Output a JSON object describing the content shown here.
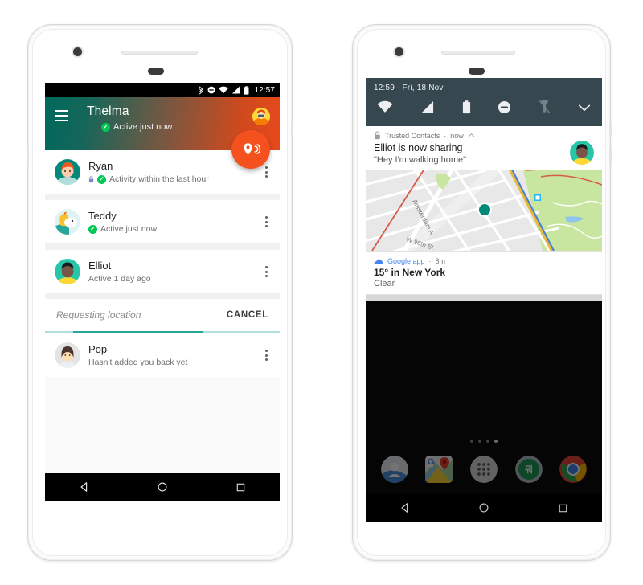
{
  "left_phone": {
    "status_bar": {
      "icons": [
        "bluetooth-icon",
        "do-not-disturb-icon",
        "wifi-icon",
        "cell-signal-icon",
        "battery-icon"
      ],
      "clock": "12:57"
    },
    "app_bar": {
      "menu_icon": "hamburger-menu-icon",
      "title": "Thelma",
      "status_icon": "verified-check-icon",
      "status": "Active just now",
      "profile_avatar": "user-avatar",
      "gradient_start": "#00695C",
      "gradient_end": "#E8491B"
    },
    "fab": {
      "label": "Share location",
      "icon": "location-broadcast-icon",
      "color": "#F4511E"
    },
    "contacts": [
      {
        "name": "Ryan",
        "status": "Activity within the last hour",
        "has_lock": true,
        "has_check": true,
        "avatar": "ryan-avatar",
        "menu": "overflow-menu-icon"
      },
      {
        "name": "Teddy",
        "status": "Active just now",
        "has_lock": false,
        "has_check": true,
        "avatar": "teddy-avatar",
        "menu": "overflow-menu-icon"
      },
      {
        "name": "Elliot",
        "status": "Active 1 day ago",
        "has_lock": false,
        "has_check": false,
        "avatar": "elliot-avatar",
        "menu": "overflow-menu-icon"
      }
    ],
    "requesting": {
      "label": "Requesting location",
      "cancel_label": "CANCEL",
      "progress_color": "#26A69A",
      "progress_track": "#B2DFDB"
    },
    "pending_contact": {
      "name": "Pop",
      "status": "Hasn't added you back yet",
      "avatar": "pop-avatar",
      "menu": "overflow-menu-icon"
    },
    "nav_bar": {
      "back": "back-nav-icon",
      "home": "home-nav-icon",
      "recents": "recents-nav-icon"
    }
  },
  "right_phone": {
    "quick_settings": {
      "time": "12:59 · Fri, 18 Nov",
      "background": "#37474F",
      "icons": [
        {
          "name": "wifi-icon",
          "dim": false
        },
        {
          "name": "cell-signal-icon",
          "dim": false
        },
        {
          "name": "battery-icon",
          "dim": false
        },
        {
          "name": "do-not-disturb-icon",
          "dim": false
        },
        {
          "name": "flashlight-off-icon",
          "dim": true
        },
        {
          "name": "chevron-down-icon",
          "dim": false
        }
      ]
    },
    "notification_sharing": {
      "app_icon": "trusted-contacts-lock-icon",
      "app_name": "Trusted Contacts",
      "time": "now",
      "collapse_icon": "chevron-up-icon",
      "title": "Elliot is now sharing",
      "message": "\"Hey I'm walking home\"",
      "avatar": "elliot-avatar",
      "map": {
        "streets": [
          "Amsterdam A",
          "W 96th St"
        ],
        "marker_color": "#00897B"
      }
    },
    "notification_weather": {
      "app_icon": "google-app-icon",
      "app_name": "Google app",
      "time": "8m",
      "title": "15° in New York",
      "subtitle": "Clear"
    },
    "home_screen": {
      "page_dots": 4,
      "active_dot": 4,
      "dock": [
        "contacts-app-icon",
        "google-maps-app-icon",
        "app-drawer-icon",
        "hangouts-app-icon",
        "chrome-app-icon"
      ]
    },
    "nav_bar": {
      "back": "back-nav-icon",
      "home": "home-nav-icon",
      "recents": "recents-nav-icon"
    }
  }
}
